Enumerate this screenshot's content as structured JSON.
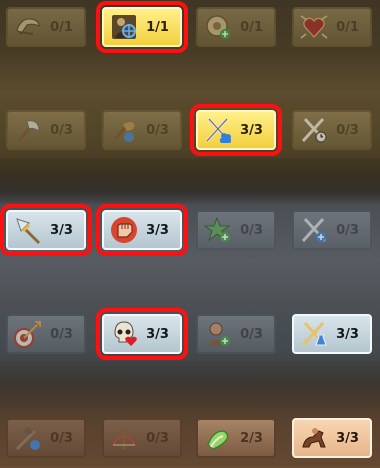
{
  "rows": [
    {
      "theme": "gold",
      "slots": [
        {
          "icon": "horn-helmet-icon",
          "count": "0/1",
          "state": "dim",
          "highlighted": false
        },
        {
          "icon": "target-reticle-icon",
          "count": "1/1",
          "state": "lit",
          "highlighted": true
        },
        {
          "icon": "round-shield-plus-icon",
          "count": "0/1",
          "state": "dim",
          "highlighted": false
        },
        {
          "icon": "heart-burst-icon",
          "count": "0/1",
          "state": "dim",
          "highlighted": false
        }
      ]
    },
    {
      "theme": "gold",
      "slots": [
        {
          "icon": "axe-icon",
          "count": "0/3",
          "state": "dim",
          "highlighted": false
        },
        {
          "icon": "shield-guard-icon",
          "count": "0/3",
          "state": "dim",
          "highlighted": false
        },
        {
          "icon": "crossed-swords-troops-icon",
          "count": "3/3",
          "state": "lit",
          "highlighted": true
        },
        {
          "icon": "crossed-swords-clock-icon",
          "count": "0/3",
          "state": "dim",
          "highlighted": false
        }
      ]
    },
    {
      "theme": "steel",
      "slots": [
        {
          "icon": "spearhead-icon",
          "count": "3/3",
          "state": "lit",
          "highlighted": true
        },
        {
          "icon": "raised-fist-icon",
          "count": "3/3",
          "state": "lit",
          "highlighted": true
        },
        {
          "icon": "green-star-plus-icon",
          "count": "0/3",
          "state": "dim",
          "highlighted": false
        },
        {
          "icon": "crossed-swords-plus-icon",
          "count": "0/3",
          "state": "dim",
          "highlighted": false
        }
      ]
    },
    {
      "theme": "steel",
      "slots": [
        {
          "icon": "arrow-target-icon",
          "count": "0/3",
          "state": "dim",
          "highlighted": false
        },
        {
          "icon": "skull-heart-icon",
          "count": "3/3",
          "state": "lit",
          "highlighted": true
        },
        {
          "icon": "soldier-plus-icon",
          "count": "0/3",
          "state": "dim",
          "highlighted": false
        },
        {
          "icon": "crossed-swords-flask-icon",
          "count": "3/3",
          "state": "lit",
          "highlighted": false
        }
      ]
    },
    {
      "theme": "copper",
      "slots": [
        {
          "icon": "wolf-sword-icon",
          "count": "0/3",
          "state": "dim",
          "highlighted": false
        },
        {
          "icon": "crossbow-icon",
          "count": "0/3",
          "state": "dim",
          "highlighted": false
        },
        {
          "icon": "healing-hand-icon",
          "count": "2/3",
          "state": "mid",
          "highlighted": false
        },
        {
          "icon": "horse-rider-icon",
          "count": "3/3",
          "state": "lit",
          "highlighted": false
        }
      ]
    }
  ]
}
